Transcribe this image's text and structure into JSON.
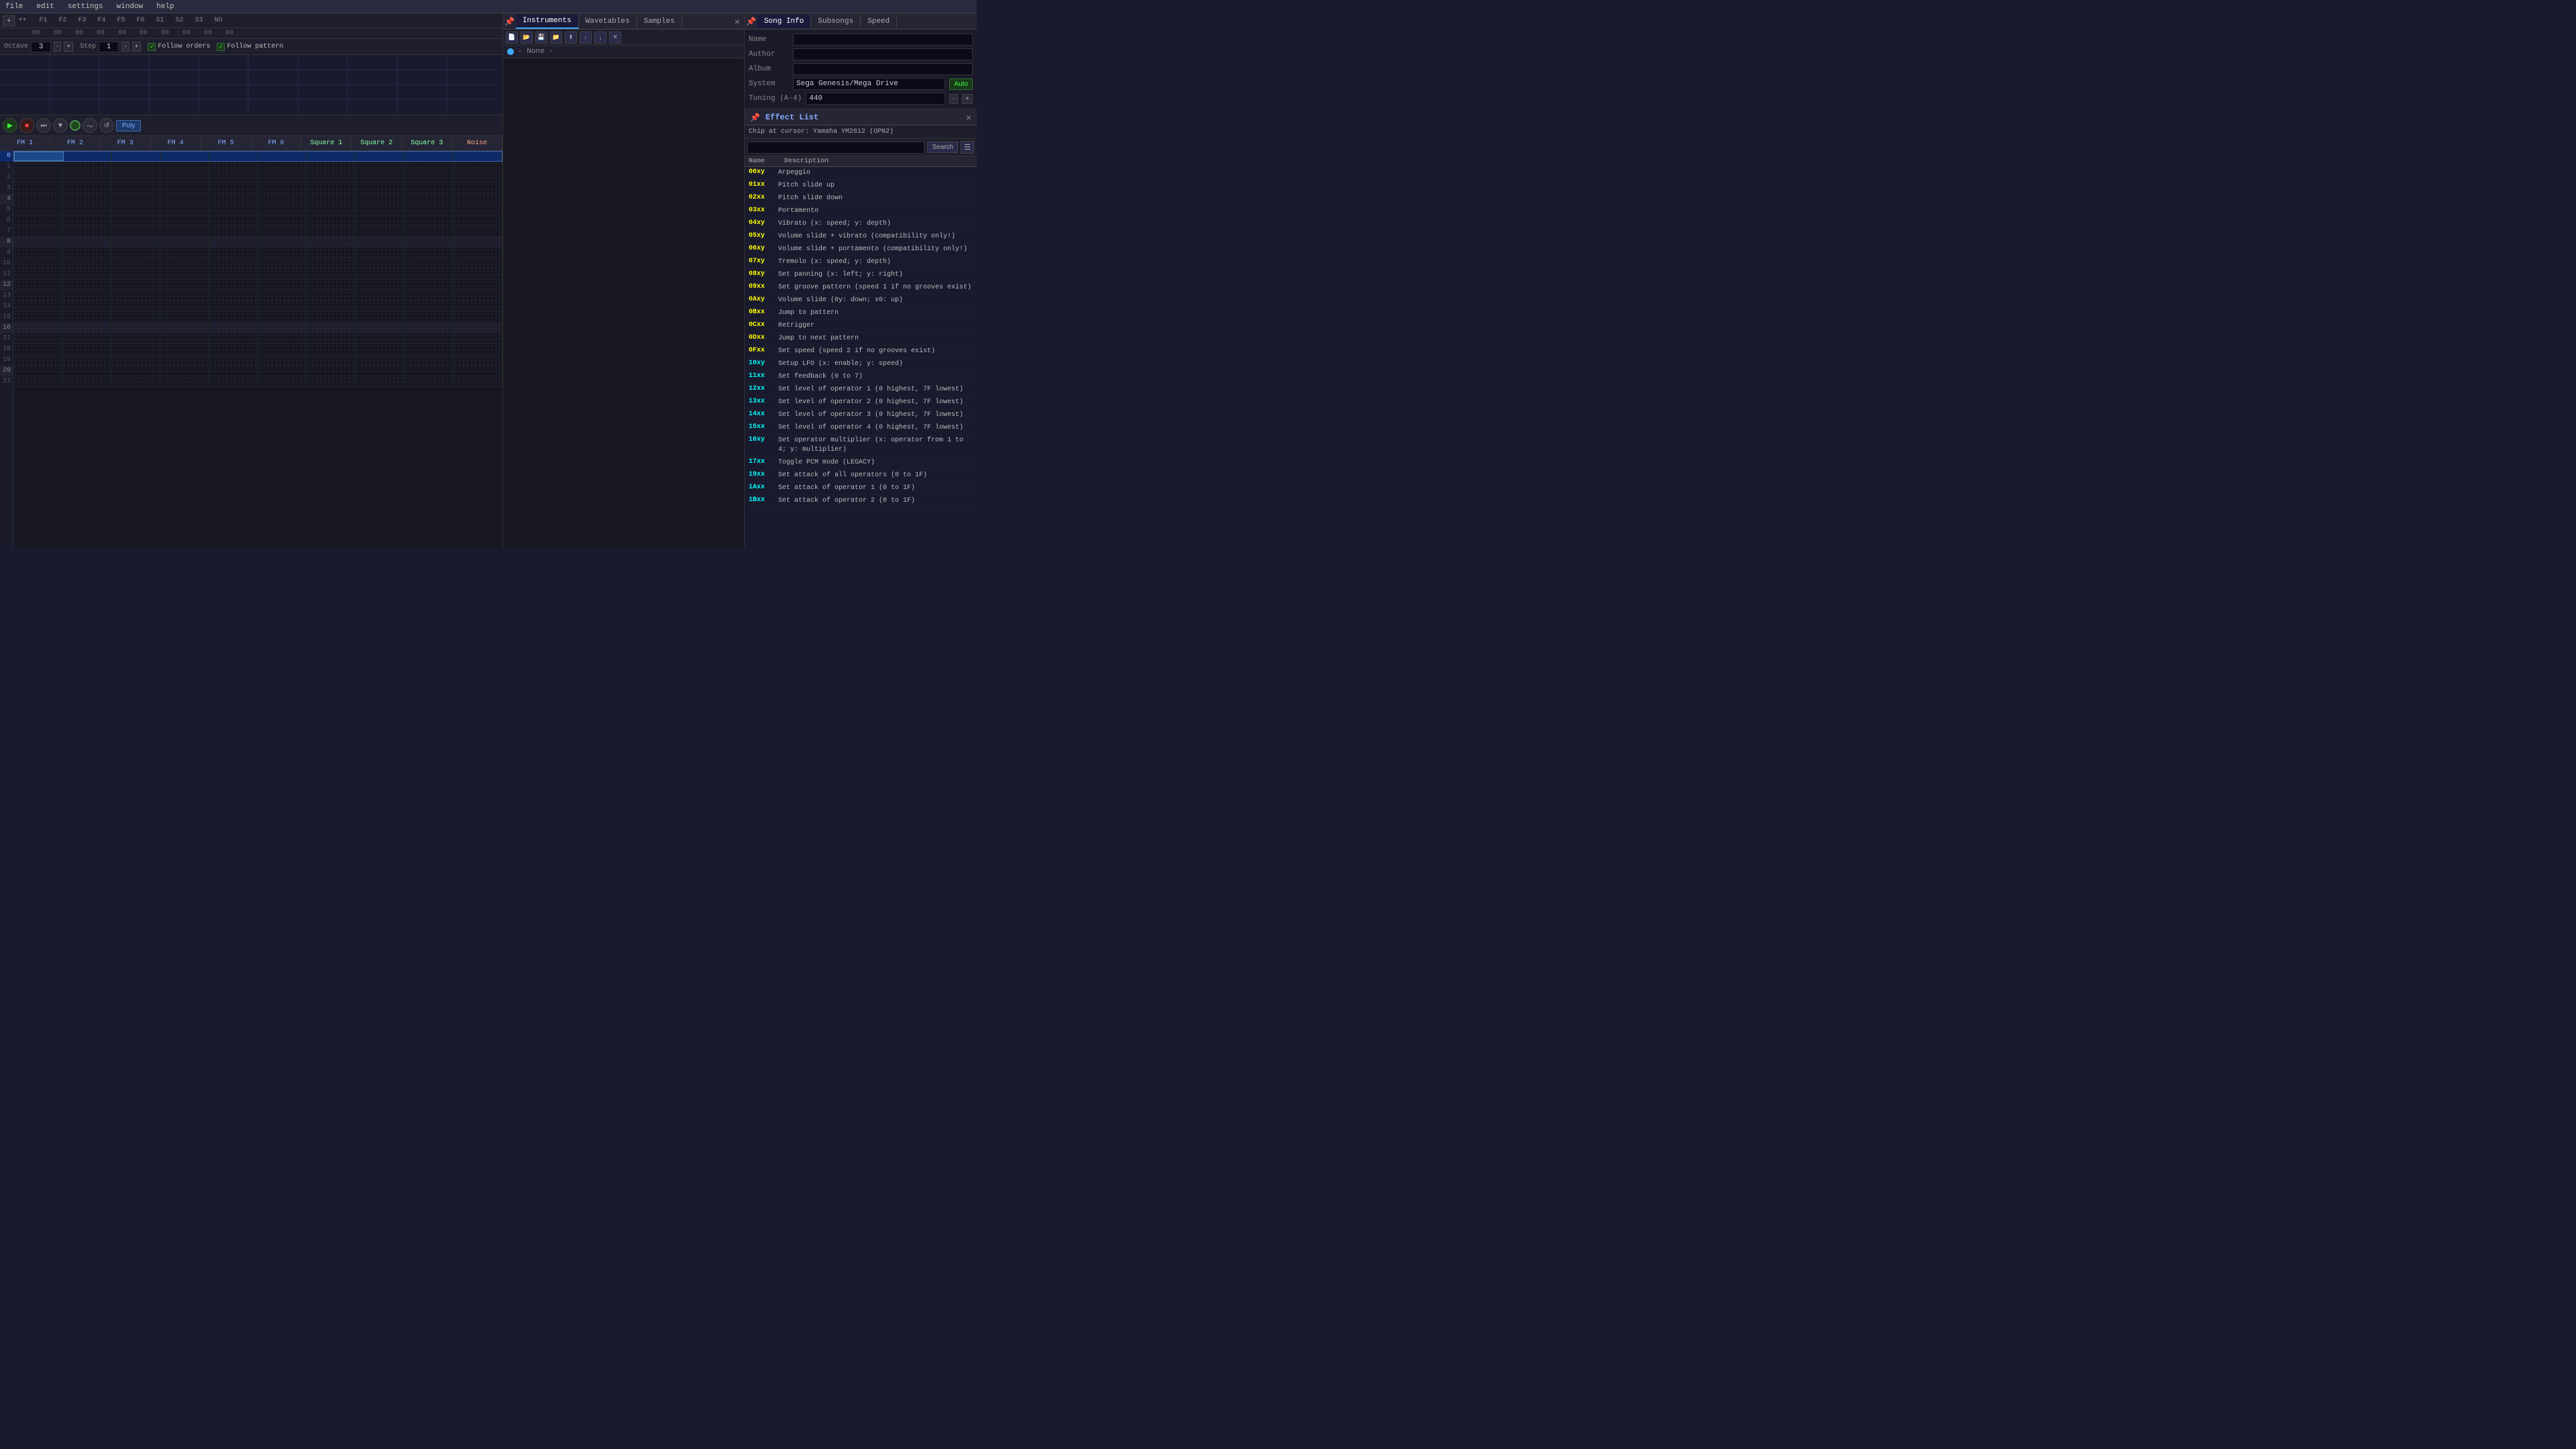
{
  "menu": {
    "items": [
      "file",
      "edit",
      "settings",
      "window",
      "help"
    ]
  },
  "top_controls": {
    "octave_label": "Octave",
    "octave_val": "3",
    "step_label": "Step",
    "step_val": "1",
    "follow_orders": "Follow orders",
    "follow_pattern": "Follow pattern"
  },
  "channel_tabs": {
    "items": [
      "F1",
      "F2",
      "F3",
      "F4",
      "F5",
      "F6",
      "S1",
      "S2",
      "S3",
      "NO"
    ]
  },
  "order_nums": {
    "items": [
      "00",
      "00",
      "00",
      "00",
      "00",
      "00",
      "00",
      "00",
      "00",
      "00"
    ]
  },
  "channel_headers": {
    "items": [
      "FM 1",
      "FM 2",
      "FM 3",
      "FM 4",
      "FM 5",
      "FM 6",
      "Square 1",
      "Square 2",
      "Square 3",
      "Noise"
    ]
  },
  "pattern": {
    "row_count": 22,
    "selected_row": 0
  },
  "instruments_panel": {
    "tabs": [
      "Instruments",
      "Wavetables",
      "Samples"
    ],
    "close_btn": "×",
    "toolbar_icons": [
      "pin",
      "new",
      "open",
      "save",
      "folder",
      "export",
      "up",
      "down",
      "delete"
    ],
    "wavetable_placeholder": "- None -"
  },
  "song_info": {
    "tabs": [
      "Song Info",
      "Subsongs",
      "Speed"
    ],
    "name_label": "Name",
    "author_label": "Author",
    "album_label": "Album",
    "system_label": "System",
    "system_value": "Sega Genesis/Mega Drive",
    "auto_btn": "Auto",
    "tuning_label": "Tuning (A-4)",
    "tuning_value": "440",
    "tune_minus": "-",
    "tune_plus": "+"
  },
  "effect_list": {
    "panel_title": "Effect List",
    "pin_icon": "📌",
    "close_icon": "×",
    "chip_label": "Chip at cursor: Yamaha YM2612 (OPN2)",
    "search_placeholder": "",
    "search_btn": "Search",
    "col_name": "Name",
    "col_desc": "Description",
    "effects": [
      {
        "code": "00xy",
        "color": "yellow",
        "desc": "Arpeggio"
      },
      {
        "code": "01xx",
        "color": "yellow",
        "desc": "Pitch slide up"
      },
      {
        "code": "02xx",
        "color": "yellow",
        "desc": "Pitch slide down"
      },
      {
        "code": "03xx",
        "color": "yellow",
        "desc": "Portamento"
      },
      {
        "code": "04xy",
        "color": "yellow",
        "desc": "Vibrato (x: speed; y: depth)"
      },
      {
        "code": "05xy",
        "color": "yellow",
        "desc": "Volume slide + vibrato (compatibility only!)"
      },
      {
        "code": "06xy",
        "color": "yellow",
        "desc": "Volume slide + portamento (compatibility only!)"
      },
      {
        "code": "07xy",
        "color": "yellow",
        "desc": "Tremolo (x: speed; y: depth)"
      },
      {
        "code": "08xy",
        "color": "yellow",
        "desc": "Set panning (x: left; y: right)"
      },
      {
        "code": "09xx",
        "color": "yellow",
        "desc": "Set groove pattern (speed 1 if no grooves exist)"
      },
      {
        "code": "0Axy",
        "color": "yellow",
        "desc": "Volume slide (0y: down; x0: up)"
      },
      {
        "code": "0Bxx",
        "color": "yellow",
        "desc": "Jump to pattern"
      },
      {
        "code": "0Cxx",
        "color": "yellow",
        "desc": "Retrigger"
      },
      {
        "code": "0Dxx",
        "color": "yellow",
        "desc": "Jump to next pattern"
      },
      {
        "code": "0Fxx",
        "color": "yellow",
        "desc": "Set speed (speed 2 if no grooves exist)"
      },
      {
        "code": "10xy",
        "color": "cyan",
        "desc": "Setup LFO (x: enable; y: speed)"
      },
      {
        "code": "11xx",
        "color": "cyan",
        "desc": "Set feedback (0 to 7)"
      },
      {
        "code": "12xx",
        "color": "cyan",
        "desc": "Set level of operator 1 (0 highest, 7F lowest)"
      },
      {
        "code": "13xx",
        "color": "cyan",
        "desc": "Set level of operator 2 (0 highest, 7F lowest)"
      },
      {
        "code": "14xx",
        "color": "cyan",
        "desc": "Set level of operator 3 (0 highest, 7F lowest)"
      },
      {
        "code": "15xx",
        "color": "cyan",
        "desc": "Set level of operator 4 (0 highest, 7F lowest)"
      },
      {
        "code": "16xy",
        "color": "cyan",
        "desc": "Set operator multiplier (x: operator from 1 to 4; y: multiplier)"
      },
      {
        "code": "17xx",
        "color": "cyan",
        "desc": "Toggle PCM mode (LEGACY)"
      },
      {
        "code": "19xx",
        "color": "cyan",
        "desc": "Set attack of all operators (0 to 1F)"
      },
      {
        "code": "1Axx",
        "color": "cyan",
        "desc": "Set attack of operator 1 (0 to 1F)"
      },
      {
        "code": "1Bxx",
        "color": "cyan",
        "desc": "Set attack of operator 2 (0 to 1F)"
      }
    ]
  },
  "row_labels": [
    "0",
    "1",
    "2",
    "3",
    "4",
    "5",
    "6",
    "7",
    "8",
    "9",
    "10",
    "11",
    "12",
    "13",
    "14",
    "15",
    "16",
    "17",
    "18",
    "19",
    "20",
    "21"
  ]
}
